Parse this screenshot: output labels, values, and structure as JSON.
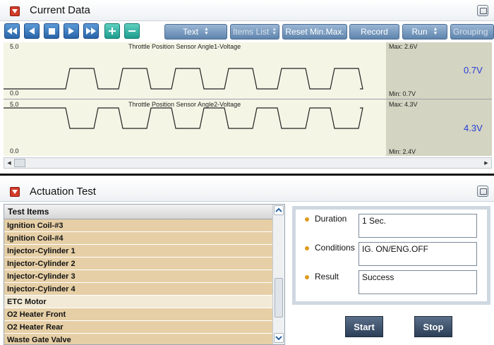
{
  "current_data": {
    "title": "Current Data",
    "toolbar": {
      "text_label": "Text",
      "items_list_label": "Items List",
      "reset_label": "Reset Min.Max.",
      "record_label": "Record",
      "run_label": "Run",
      "grouping_label": "Grouping"
    },
    "graphs": [
      {
        "label": "Throttle Position Sensor Angle1-Voltage",
        "ymax": "5.0",
        "ymin": "0.0",
        "max_text": "Max: 2.6V",
        "min_text": "Min: 0.7V",
        "value": "0.7V"
      },
      {
        "label": "Throttle Position Sensor Angle2-Voltage",
        "ymax": "5.0",
        "ymin": "0.0",
        "max_text": "Max: 4.3V",
        "min_text": "Min: 2.4V",
        "value": "4.3V"
      }
    ]
  },
  "actuation_test": {
    "title": "Actuation Test",
    "list_header": "Test Items",
    "items": [
      {
        "label": "Ignition Coil-#3",
        "selected": false
      },
      {
        "label": "Ignition Coil-#4",
        "selected": false
      },
      {
        "label": "Injector-Cylinder 1",
        "selected": false
      },
      {
        "label": "Injector-Cylinder 2",
        "selected": false
      },
      {
        "label": "Injector-Cylinder 3",
        "selected": false
      },
      {
        "label": "Injector-Cylinder 4",
        "selected": false
      },
      {
        "label": "ETC Motor",
        "selected": true
      },
      {
        "label": "O2 Heater Front",
        "selected": false
      },
      {
        "label": "O2 Heater Rear",
        "selected": false
      },
      {
        "label": "Waste Gate Valve",
        "selected": false
      }
    ],
    "details": {
      "duration_label": "Duration",
      "duration_value": "1 Sec.",
      "conditions_label": "Conditions",
      "conditions_value": "IG. ON/ENG.OFF",
      "result_label": "Result",
      "result_value": "Success"
    },
    "start_label": "Start",
    "stop_label": "Stop"
  },
  "colors": {
    "accent_red": "#d23b2a",
    "value_blue": "#2540d6",
    "list_bg": "#e6cfa6",
    "list_selected": "#f2ead6",
    "graph_bg": "#f5f5e6",
    "graph_panel": "#d4d4c2",
    "bullet": "#e09a1e"
  }
}
